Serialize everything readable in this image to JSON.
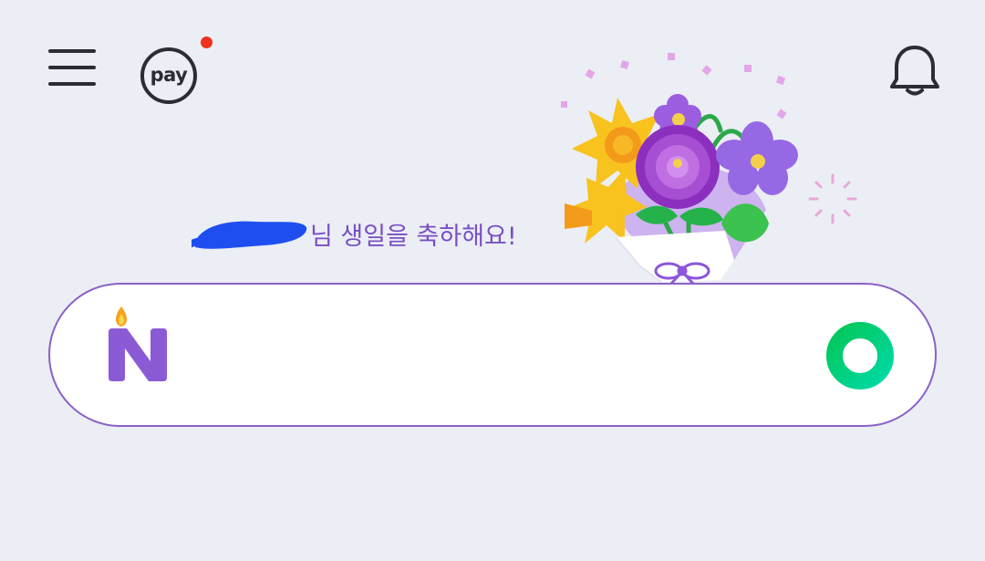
{
  "header": {
    "menu_icon": "hamburger-menu-icon",
    "pay_label": "pay",
    "pay_badge_color": "#f0321e",
    "bell_icon": "bell-icon"
  },
  "greeting": {
    "suffix_text": "님 생일을 축하해요!",
    "color": "#7a4fc2"
  },
  "doodle": {
    "image": "birthday-flower-bouquet"
  },
  "search": {
    "placeholder": "",
    "value": "",
    "border_color": "#8b61c6",
    "logo_icon": "naver-n-birthday-candle-icon",
    "action_icon": "green-search-ring-icon"
  },
  "colors": {
    "background": "#ebeef5",
    "accent_purple": "#8b5bd6",
    "accent_green": "#03cf5d"
  }
}
